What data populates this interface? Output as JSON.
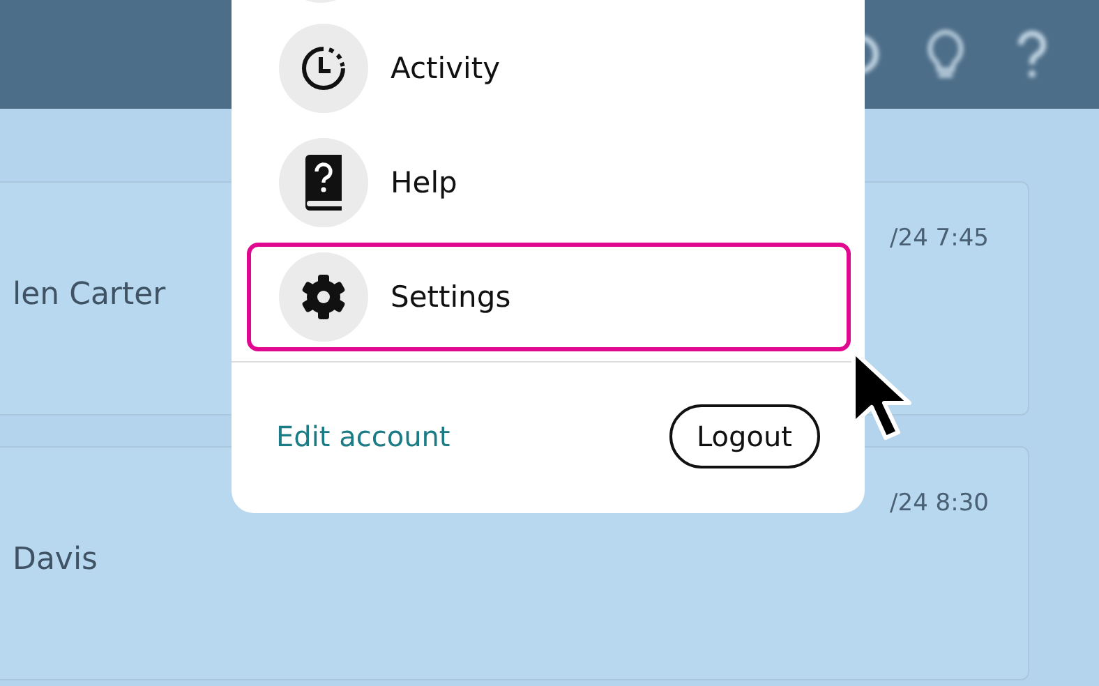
{
  "background": {
    "cards": [
      {
        "name": "len Carter",
        "time": "/24 7:45"
      },
      {
        "name": "Davis",
        "time": "/24 8:30"
      }
    ]
  },
  "menu": {
    "items": [
      {
        "label": "Activity",
        "kind": "clock",
        "selected": false
      },
      {
        "label": "Help",
        "kind": "book",
        "selected": false
      },
      {
        "label": "Settings",
        "kind": "gear",
        "selected": true
      }
    ],
    "edit_link": "Edit account",
    "logout": "Logout"
  }
}
